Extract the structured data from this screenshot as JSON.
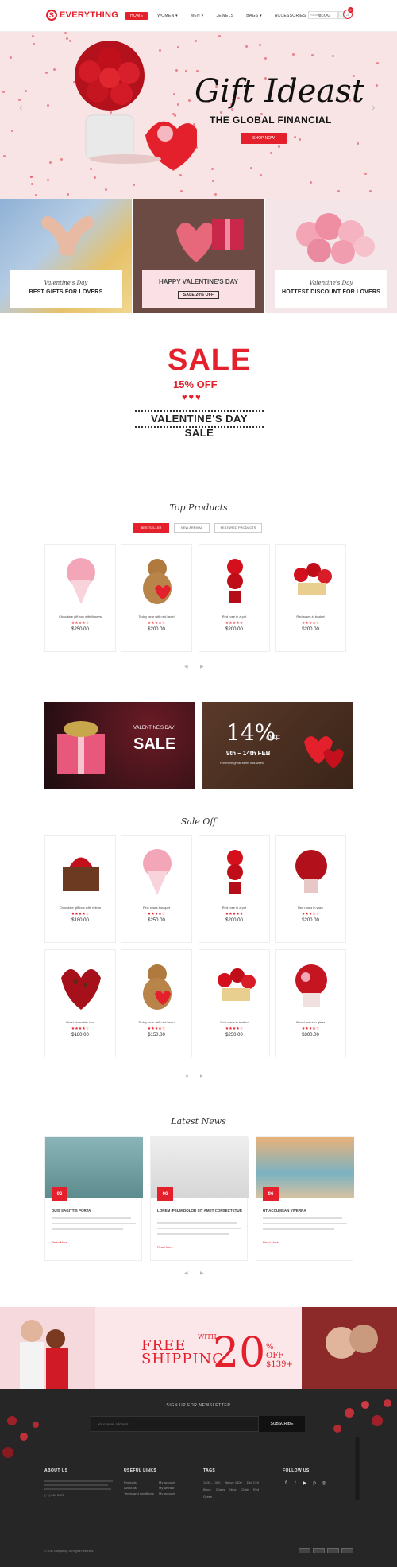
{
  "header": {
    "brand": "EVERYTHING",
    "brand_initial": "S",
    "nav": [
      "HOME",
      "WOMEN",
      "MEN",
      "JEWELS",
      "BAGS",
      "ACCESSORIES",
      "BLOG"
    ],
    "search_placeholder": "SEARCH",
    "cart_count": "0"
  },
  "hero": {
    "title": "Gift Ideast",
    "subtitle": "THE GLOBAL FINANCIAL",
    "button": "SHOP NOW"
  },
  "tiles": [
    {
      "script": "Valentine's Day",
      "headline": "BEST GIFTS FOR LOVERS"
    },
    {
      "script": "HAPPY VALENTINE'S DAY",
      "headline": "SALE 20% OFF"
    },
    {
      "script": "Valentine's Day",
      "headline": "HOTTEST DISCOUNT FOR LOVERS"
    }
  ],
  "sale": {
    "word": "SALE",
    "off": "15% OFF",
    "hearts": "♥♥♥",
    "line": "VALENTINE'S DAY SALE"
  },
  "top_products": {
    "title": "Top Products",
    "tabs": [
      "BESTSELLER",
      "NEW ARRIVAL",
      "FEATURED PRODUCTS"
    ],
    "items": [
      {
        "name": "Chocolate gift box with flowers",
        "stars": "★★★★☆",
        "price": "$250.00"
      },
      {
        "name": "Teddy bear with red heart",
        "stars": "★★★★☆",
        "price": "$200.00"
      },
      {
        "name": "Red rose in a pot",
        "stars": "★★★★★",
        "price": "$200.00"
      },
      {
        "name": "Red roses in basket",
        "stars": "★★★★☆",
        "price": "$200.00"
      }
    ]
  },
  "banners": {
    "left_top": "VALENTINE'S DAY",
    "left_big": "SALE",
    "right_pct": "14%",
    "right_off": "OFF",
    "right_dates": "9th – 14th FEB",
    "right_note": "For more great items this week"
  },
  "sale_off": {
    "title": "Sale Off",
    "items": [
      {
        "name": "Chocolate gift box with ribbon",
        "stars": "★★★★☆",
        "price": "$180.00"
      },
      {
        "name": "Pink roses bouquet",
        "stars": "★★★★☆",
        "price": "$250.00"
      },
      {
        "name": "Red rose in a pot",
        "stars": "★★★★★",
        "price": "$200.00"
      },
      {
        "name": "Red roses in vase",
        "stars": "★★★☆☆",
        "price": "$200.00"
      },
      {
        "name": "Heart chocolate box",
        "stars": "★★★★☆",
        "price": "$180.00"
      },
      {
        "name": "Teddy bear with red heart",
        "stars": "★★★★☆",
        "price": "$150.00"
      },
      {
        "name": "Red roses in basket",
        "stars": "★★★★☆",
        "price": "$250.00"
      },
      {
        "name": "Mixed roses in glass",
        "stars": "★★★★☆",
        "price": "$300.00"
      }
    ]
  },
  "news": {
    "title": "Latest News",
    "items": [
      {
        "date": "06",
        "title": "DUIS SAGITTIS PORTA",
        "more": "Read More"
      },
      {
        "date": "06",
        "title": "LOREM IPSUM DOLOR SIT AMET CONSECTETUR",
        "more": "Read More"
      },
      {
        "date": "06",
        "title": "UT ACCUMSAN VIVERRA",
        "more": "Read More"
      }
    ]
  },
  "shipping": {
    "free": "FREE",
    "shipping": "SHIPPING",
    "with": "WITH",
    "pct": "20",
    "off": "OFF",
    "over": "$139+"
  },
  "footer": {
    "newsletter_title": "SIGN UP FOR NEWSLETTER",
    "newsletter_placeholder": "Your email address...",
    "subscribe": "SUBSCRIBE",
    "col1_title": "ABOUT US",
    "col2_title": "USEFUL LINKS",
    "col3_title": "TAGS",
    "col4_title": "FOLLOW US",
    "links": [
      "Products",
      "About us",
      "Terms and conditions",
      "My account",
      "My wishlist",
      "My account"
    ],
    "tags": [
      "1200 - 1300",
      "Above 1300",
      "Dell Cell",
      "Black",
      "Chairs",
      "New",
      "Chair",
      "Red",
      "Green"
    ],
    "phone": "(+1) 234 5678",
    "copyright": "© 2017 Everything. All Rights Reserved."
  }
}
